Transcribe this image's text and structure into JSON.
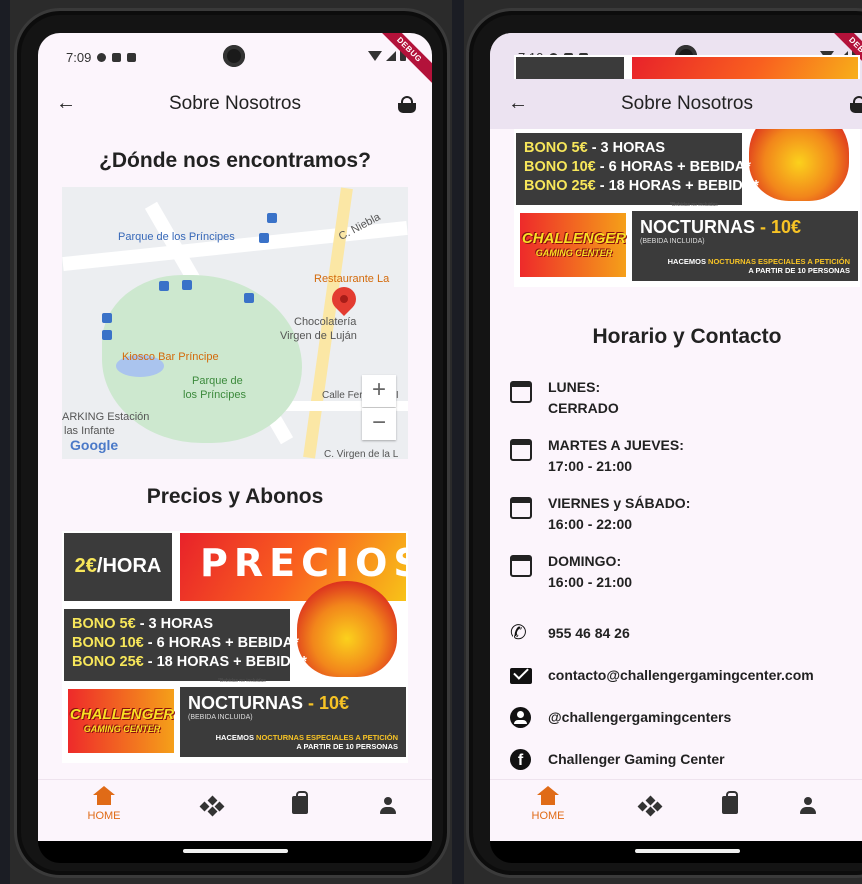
{
  "status_left": {
    "time": "7:09"
  },
  "status_right": {
    "time": "7:10"
  },
  "debug_label": "DEBUG",
  "appbar": {
    "title": "Sobre Nosotros"
  },
  "left": {
    "location_title": "¿Dónde nos encontramos?",
    "prices_title": "Precios y Abonos",
    "map": {
      "labels": {
        "parque_principes": "Parque de los Príncipes",
        "c_niebla": "C. Niebla",
        "restaurante": "Restaurante La",
        "chocolateria_1": "Chocolatería",
        "chocolateria_2": "Virgen de Luján",
        "kiosco": "Kiosco Bar Príncipe",
        "parque_1": "Parque de",
        "parque_2": "los Príncipes",
        "calle_fernando": "Calle Fernando II",
        "parking_1": "ARKING Estación",
        "parking_2": "las Infante",
        "c_virgen": "C. Virgen de la L",
        "google": "Google"
      },
      "zoom_in": "+",
      "zoom_out": "−"
    }
  },
  "banner": {
    "price_hour_value": "2€",
    "price_hour_unit": "/HORA",
    "precios": "PRECIOS",
    "bonos": [
      {
        "name": "BONO 5€",
        "detail": " - 3 HORAS"
      },
      {
        "name": "BONO 10€",
        "detail": " - 6 HORAS + BEBIDA*"
      },
      {
        "name": "BONO 25€",
        "detail": " - 18 HORAS + BEBIDA*"
      }
    ],
    "footnote": "*Bebidas no incluidas",
    "logo_main": "CHALLENGER",
    "logo_sub": "GAMING CENTER",
    "nocturnas": "NOCTURNAS",
    "nocturnas_price": " - 10€",
    "nocturnas_sub": "(BEBIDA INCLUIDA)",
    "nocturnas_line1_a": "HACEMOS ",
    "nocturnas_line1_b": "NOCTURNAS ESPECIALES A PETICIÓN",
    "nocturnas_line2": "A PARTIR DE 10 PERSONAS"
  },
  "right": {
    "schedule_title": "Horario y Contacto",
    "schedule": [
      {
        "day": "LUNES:",
        "hours": "CERRADO"
      },
      {
        "day": "MARTES A JUEVES:",
        "hours": "17:00 - 21:00"
      },
      {
        "day": "VIERNES y SÁBADO:",
        "hours": "16:00 - 22:00"
      },
      {
        "day": "DOMINGO:",
        "hours": "16:00 - 21:00"
      }
    ],
    "contact": {
      "phone": "955 46 84 26",
      "email": "contacto@challengergamingcenter.com",
      "instagram": "@challengergamingcenters",
      "facebook": "Challenger Gaming Center"
    }
  },
  "bottom_nav": {
    "home_label": "HOME"
  },
  "colors": {
    "accent": "#e06b17",
    "background": "#fcf5fc"
  }
}
